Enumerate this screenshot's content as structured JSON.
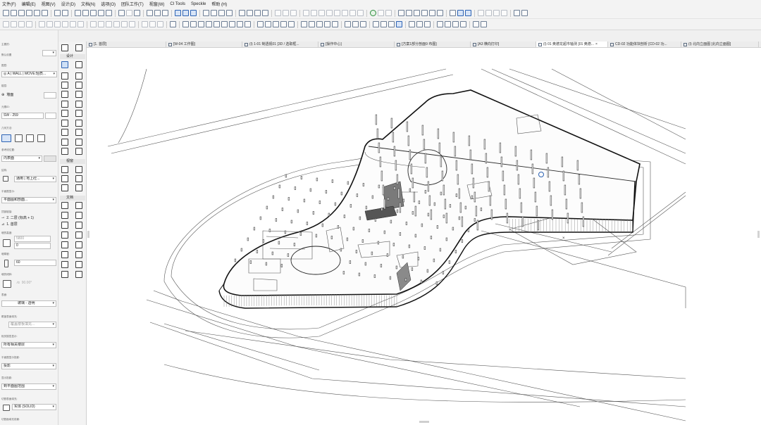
{
  "menu": [
    "文件(F)",
    "编辑(E)",
    "视图(V)",
    "设计(D)",
    "文档(N)",
    "选项(O)",
    "团队工作(T)",
    "视窗(W)",
    "CI Tools",
    "Speckle",
    "帮助 (H)"
  ],
  "infobox": {
    "main_label": "主要的:",
    "default_label": "默认设置",
    "layer_label": "图层:",
    "layer_value": "A | WALL | MOVE:轻质...",
    "floor_label": "楼层:",
    "floor_value": "墙面",
    "id_label": "元素ID:",
    "id_value": "SW - 259",
    "geometry_label": "几何方法:",
    "ref_line_label": "参考线位置:",
    "ref_line_value": "内表面",
    "structure_label": "结构:",
    "structure_value": "通用 | 地上砼...",
    "display_label": "平面图显示:",
    "display_value": "平面图和剖面...",
    "top_label": "顶部链接:",
    "top_value_1": "2. 二层 (标高 + 1)",
    "bottom_label": "",
    "bottom_value": "1. 首层",
    "height_label": "墙的高度:",
    "height_value": "5800",
    "offset_value": "0",
    "thickness_label": "墙厚度:",
    "thickness_value": "60",
    "slant_label": "墙的倾斜:",
    "slant_value": "90.00°",
    "surface_label": "表面:",
    "surface_value": "玻璃 - 透明",
    "override_label": "覆盖表面填充:",
    "override_value": "覆盖楼板填充...",
    "related_label": "相关楼层显示:",
    "related_value": "所有相关楼层",
    "plan_show_label": "平面图显示投影:",
    "plan_show_value": "投影",
    "show_on_label": "显示投影:",
    "show_on_value": "到平面图范围",
    "cut_fill_label": "切割表面填充:",
    "cut_fill_value": "实体 (SOLID)",
    "bottom_note": "切割面填充前景:"
  },
  "toolbox": {
    "section_design": "设计",
    "section_view": "视窗",
    "section_doc": "文档"
  },
  "tabs": [
    {
      "label": "[1. 首层]",
      "active": false
    },
    {
      "label": "[W-04 工作图]",
      "active": false
    },
    {
      "label": "(I) 1-01 制透视01 [3D / 选取框...",
      "active": false
    },
    {
      "label": "[操作中心]",
      "active": false
    },
    {
      "label": "[方案1部分剖面9 布图]",
      "active": false
    },
    {
      "label": "[A3 横向打印]",
      "active": false
    },
    {
      "label": "(I) 01 奥德龙超市轴测 [01 奥德...",
      "active": true
    },
    {
      "label": "CD-02 功能体块剖析 [CD-02 功...",
      "active": false
    },
    {
      "label": "(I) 北向立面图 [北向立面图]",
      "active": false
    }
  ],
  "colors": {
    "ui_bg": "#f3f3f3",
    "accent": "#2d63b4",
    "viewport_bg": "#ffffff",
    "drawing_line": "#1a1a1a"
  }
}
